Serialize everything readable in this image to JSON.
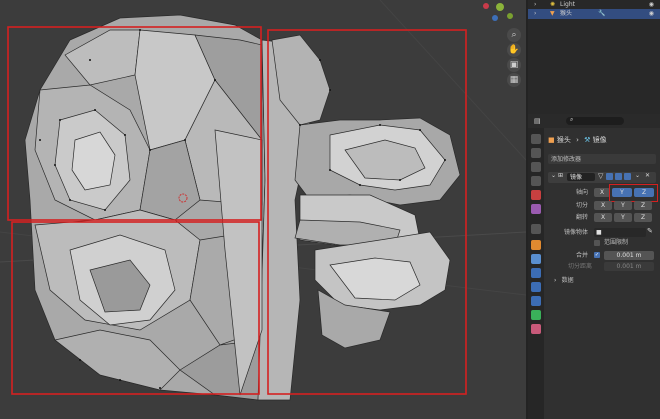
{
  "outliner": {
    "items": [
      {
        "label": "Light",
        "selected": false
      },
      {
        "label": "猴头",
        "selected": true
      }
    ]
  },
  "properties": {
    "breadcrumb": {
      "object": "猴头",
      "modifier": "镜像"
    },
    "add_modifier_label": "添加修改器",
    "modifier": {
      "name": "镜像",
      "axis_label": "轴向",
      "bisect_label": "切分",
      "flip_label": "翻转",
      "axes": [
        "X",
        "Y",
        "Z"
      ],
      "mirror_object_label": "镜像物体",
      "clipping_label": "范围限制",
      "merge_label": "合并",
      "merge_value": "0.001 m",
      "bisect_distance_label": "切分距离",
      "bisect_distance_value": "0.001 m",
      "data_label": "数据"
    }
  },
  "colors": {
    "accent": "#4772b3",
    "highlight_box": "#d42020"
  }
}
